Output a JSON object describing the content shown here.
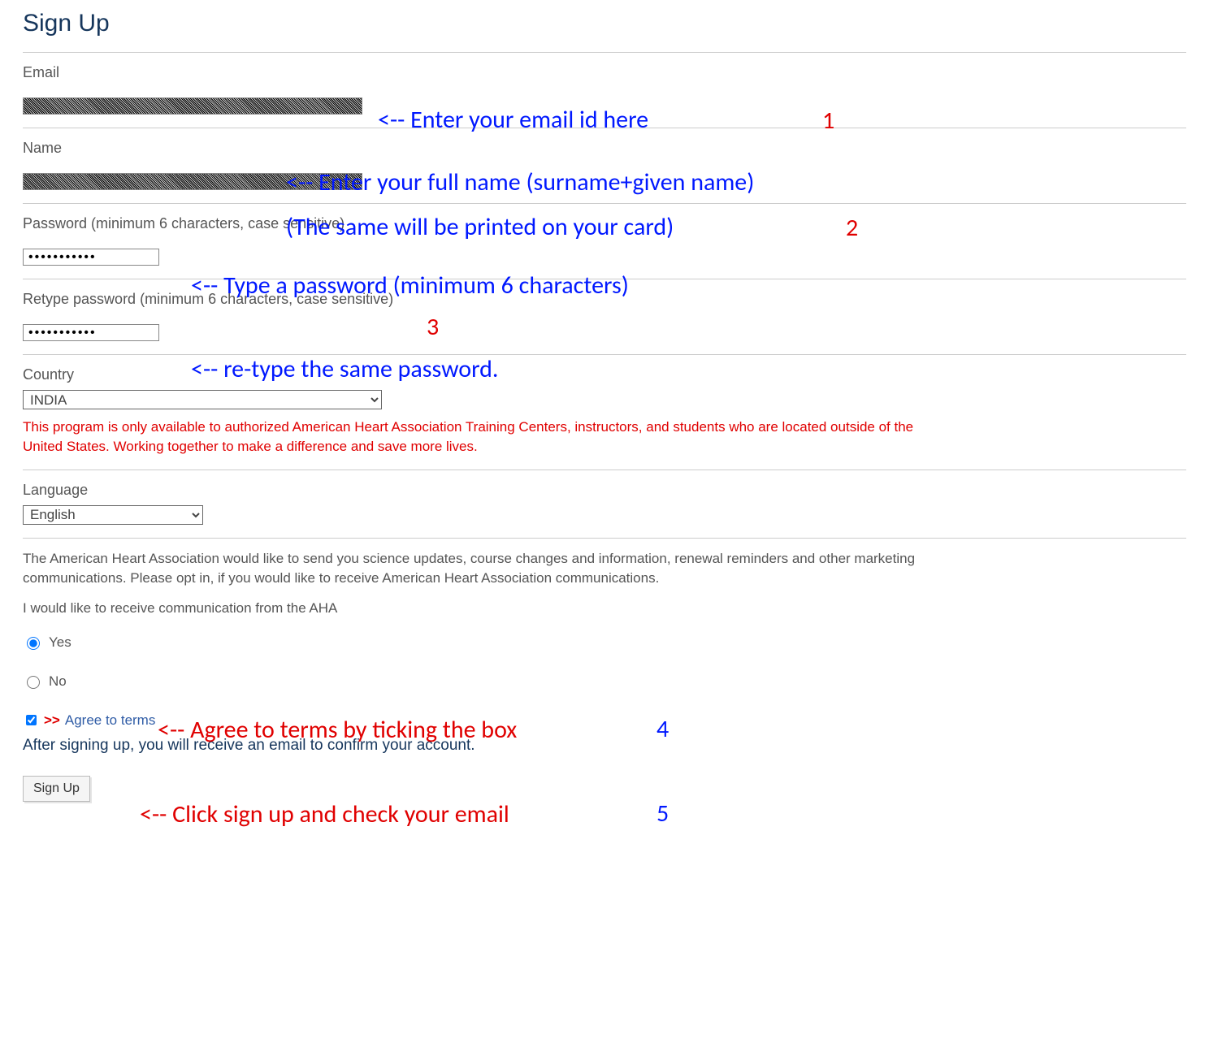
{
  "title": "Sign Up",
  "fields": {
    "email_label": "Email",
    "name_label": "Name",
    "password_label": "Password (minimum 6 characters, case sensitive)",
    "retype_label": "Retype password (minimum 6 characters, case sensitive)",
    "country_label": "Country",
    "language_label": "Language"
  },
  "values": {
    "country_selected": "INDIA",
    "language_selected": "English",
    "password_mask": "•••••••••••",
    "retype_mask": "•••••••••••"
  },
  "disclaimer": "This program is only available to authorized American Heart Association Training Centers, instructors, and students who are located outside of the United States. Working together to make a difference and save more lives.",
  "optin": {
    "description": "The American Heart Association would like to send you science updates, course changes and information, renewal reminders and other marketing communications. Please opt in, if you would like to receive American Heart Association communications.",
    "prompt": "I would like to receive communication from the AHA",
    "yes": "Yes",
    "no": "No"
  },
  "terms": {
    "arrows": ">>",
    "link": "Agree to terms"
  },
  "confirm_note": "After signing up, you will receive an email to confirm your account.",
  "submit_label": "Sign Up",
  "annotations": {
    "a1": "<-- Enter your email id here",
    "a2a": "<-- Enter your full name (surname+given name)",
    "a2b": "(The same will be printed on your card)",
    "a3": "<-- Type a password (minimum 6 characters)",
    "a4": "<-- re-type the same password.",
    "a5": "<-- Agree to terms by ticking the box",
    "a6": "<-- Click sign up and check your email",
    "n1": "1",
    "n2": "2",
    "n3": "3",
    "n4": "4",
    "n5": "5"
  }
}
